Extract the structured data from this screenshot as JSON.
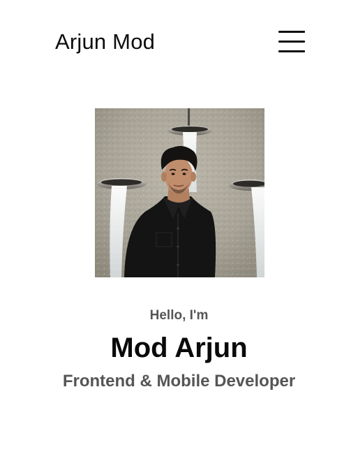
{
  "header": {
    "brand_name": "Arjun Mod",
    "menu_icon": "hamburger-menu-icon"
  },
  "hero": {
    "photo_alt": "Portrait of Mod Arjun in front of a stone wall with water fountains",
    "greeting": "Hello, I'm",
    "name": "Mod Arjun",
    "role": "Frontend & Mobile Developer"
  },
  "colors": {
    "text_primary": "#0a0a0a",
    "text_secondary": "#555555",
    "background": "#ffffff"
  }
}
